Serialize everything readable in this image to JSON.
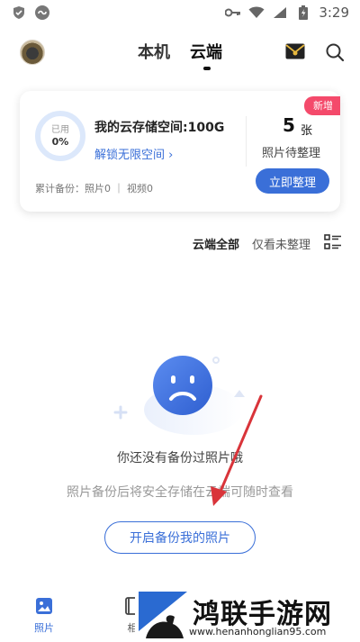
{
  "status_bar": {
    "time": "3:29",
    "icons_left": [
      "shield-check-icon",
      "link-icon"
    ],
    "icons_right": [
      "key-icon",
      "wifi-icon",
      "signal-icon",
      "battery-icon"
    ]
  },
  "top_bar": {
    "tabs": [
      {
        "label": "本机",
        "active": false
      },
      {
        "label": "云端",
        "active": true
      }
    ],
    "icons": [
      "mail-icon",
      "search-icon"
    ]
  },
  "storage_card": {
    "ring_label": "已用",
    "ring_value": "0%",
    "space_title": "我的云存储空间:100G",
    "unlock_link": "解锁无限空间 ›",
    "backup_stats": "累计备份：照片0 ｜ 视频0",
    "new_badge": "新增",
    "pending_count": "5",
    "pending_unit": "张",
    "pending_label": "照片待整理",
    "organize_button": "立即整理"
  },
  "filter_bar": {
    "all": "云端全部",
    "unsorted": "仅看未整理"
  },
  "empty_state": {
    "title": "你还没有备份过照片哦",
    "description": "照片备份后将安全存储在云端可随时查看",
    "button": "开启备份我的照片"
  },
  "bottom_nav": {
    "items": [
      {
        "label": "照片",
        "active": true
      },
      {
        "label": "相"
      }
    ]
  },
  "watermark": {
    "title": "鸿联手游网",
    "url": "www.henanhonglian95.com"
  },
  "colors": {
    "accent": "#3a6fd8",
    "badge": "#f44a6b",
    "arrow": "#d9343a"
  }
}
